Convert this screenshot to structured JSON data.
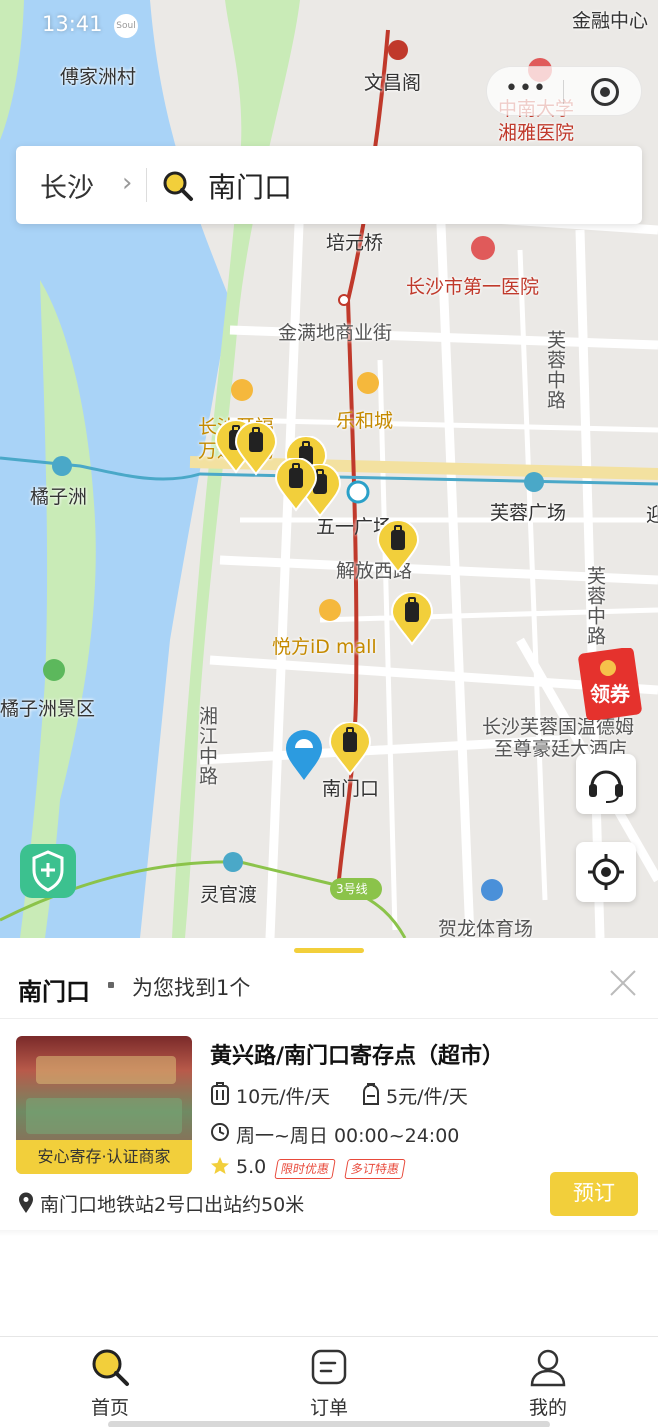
{
  "status_bar": {
    "time": "13:41",
    "app_icon": "Soul"
  },
  "capsule": {
    "menu_icon": "more-dots-icon",
    "close_icon": "record-icon"
  },
  "search": {
    "city": "长沙",
    "query": "南门口"
  },
  "map": {
    "labels": {
      "fujiazhoucun": "傅家洲村",
      "wenchangge": "文昌阁",
      "zhongnan": "中南大学",
      "xiangya": "湘雅医院",
      "top_right": "金融中心",
      "peiyuanqiao": "培元桥",
      "diyi_yiyuan": "长沙市第一医院",
      "jinmandi": "金满地商业街",
      "furong_zhonglu": "芙蓉中路",
      "lehecheng": "乐和城",
      "kaifu": "长沙开福",
      "wanda": "万达广场",
      "juzizhou": "橘子洲",
      "wuyi_guangchang": "五一广场",
      "furong_guangchang": "芙蓉广场",
      "jiefang_xilu": "解放西路",
      "yuefang": "悦方iD mall",
      "furong_zhonglu2": "芙蓉中路",
      "juzizhou_jingqu": "橘子洲景区",
      "xiangjiang_zhonglu": "湘江中路",
      "hotel1": "长沙芙蓉国温德姆",
      "hotel2": "至尊豪廷大酒店",
      "nanmenkou": "南门口",
      "lingguandu": "灵官渡",
      "line3": "3号线",
      "helong": "贺龙体育场",
      "right_edge": "迎"
    },
    "colors": {
      "river": "#a9d3f7",
      "island": "#c9ebb7",
      "metro_red": "#c0392b",
      "metro_blue": "#4aa8c8",
      "metro_green": "#8bc34a",
      "accent": "#f2cf3b"
    }
  },
  "coupon": {
    "label": "领券"
  },
  "float_buttons": {
    "service": "headset-icon",
    "locate": "locate-icon",
    "safety": "shield-plus-icon"
  },
  "sheet": {
    "title": "南门口",
    "result_text": "为您找到1个",
    "card": {
      "badge": "安心寄存·认证商家",
      "name": "黄兴路/南门口寄存点（超市）",
      "price_large": "10元/件/天",
      "price_small": "5元/件/天",
      "hours": "周一~周日 00:00~24:00",
      "rating": "5.0",
      "tags": [
        "限时优惠",
        "多订特惠"
      ],
      "address": "南门口地铁站2号口出站约50米",
      "book_label": "预订"
    }
  },
  "tabbar": {
    "tabs": [
      {
        "label": "首页",
        "icon": "search-home-icon",
        "active": true
      },
      {
        "label": "订单",
        "icon": "order-icon",
        "active": false
      },
      {
        "label": "我的",
        "icon": "profile-icon",
        "active": false
      }
    ]
  }
}
